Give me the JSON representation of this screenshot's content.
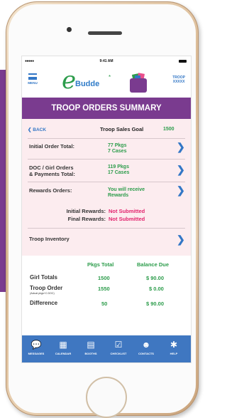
{
  "status": {
    "dots": "●●●●●",
    "time": "9:41 AM"
  },
  "header": {
    "menu_label": "MENU",
    "logo_e": "e",
    "logo_text": "Budde",
    "logo_mark": "*",
    "troop_line1": "TROOP",
    "troop_line2": "XXXXX"
  },
  "page_title": "TROOP ORDERS SUMMARY",
  "back_label": "BACK",
  "goal": {
    "label": "Troop Sales Goal",
    "value": "1500"
  },
  "rows": [
    {
      "label_line1": "Initial Order Total:",
      "label_line2": "",
      "value_line1": "77 Pkgs",
      "value_line2": "7 Cases"
    },
    {
      "label_line1": "DOC / Girl Orders",
      "label_line2": "& Payments Total:",
      "value_line1": "119 Pkgs",
      "value_line2": "17 Cases"
    },
    {
      "label_line1": "Rewards Orders:",
      "label_line2": "",
      "value_line1": "You will receive",
      "value_line2": "Rewards"
    },
    {
      "label_line1": "Troop Inventory",
      "label_line2": "",
      "value_line1": "",
      "value_line2": ""
    }
  ],
  "rewards_status": [
    {
      "label": "Initial Rewards:",
      "value": "Not Submitted"
    },
    {
      "label": "Final Rewards:",
      "value": "Not Submitted"
    }
  ],
  "totals": {
    "headers": [
      "Pkgs Total",
      "Balance Due"
    ],
    "rows": [
      {
        "label": "Girl Totals",
        "sub": "",
        "pkgs": "1500",
        "balance": "$ 90.00"
      },
      {
        "label": "Troop Order",
        "sub": "(Actual pkgs+C.DOC)",
        "pkgs": "1550",
        "balance": "$  0.00"
      },
      {
        "label": "Difference",
        "sub": "",
        "pkgs": "50",
        "balance": "$ 90.00"
      }
    ]
  },
  "tabs": [
    {
      "label": "MESSAGES",
      "icon": "messages-icon"
    },
    {
      "label": "CALENDAR",
      "icon": "calendar-icon"
    },
    {
      "label": "BOOTHS",
      "icon": "booths-icon"
    },
    {
      "label": "CHECKLIST",
      "icon": "checklist-icon"
    },
    {
      "label": "CONTACTS",
      "icon": "contacts-icon"
    },
    {
      "label": "HELP",
      "icon": "help-icon"
    }
  ],
  "colors": {
    "purple": "#7a3b8f",
    "green": "#2c9c4b",
    "blue": "#3377c6",
    "pink": "#e2246e",
    "tabbar": "#3f77c1",
    "content_bg": "#fcecef"
  }
}
